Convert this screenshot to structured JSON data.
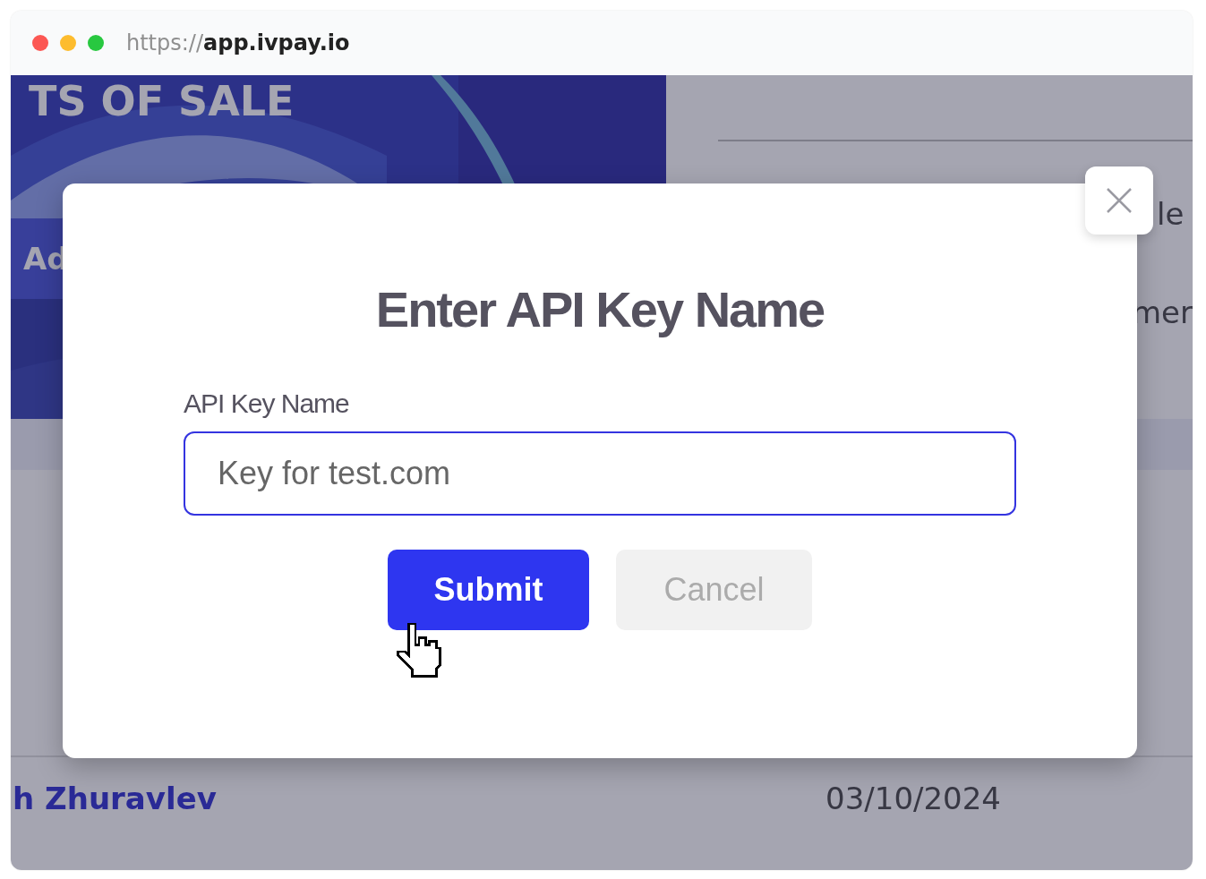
{
  "browser": {
    "url": {
      "scheme": "https://",
      "host": "app.ivpay.io"
    }
  },
  "background": {
    "banner": {
      "heading": "TS OF SALE",
      "button": "Ad"
    },
    "side_texts": [
      "le",
      "mer"
    ],
    "row": {
      "name": "h Zhuravlev",
      "date": "03/10/2024"
    }
  },
  "dialog": {
    "title": "Enter API Key Name",
    "field": {
      "label": "API Key Name",
      "value": "Key for test.com"
    },
    "buttons": [
      {
        "label": "Submit",
        "kind": "primary"
      },
      {
        "label": "Cancel",
        "kind": "secondary"
      }
    ]
  }
}
